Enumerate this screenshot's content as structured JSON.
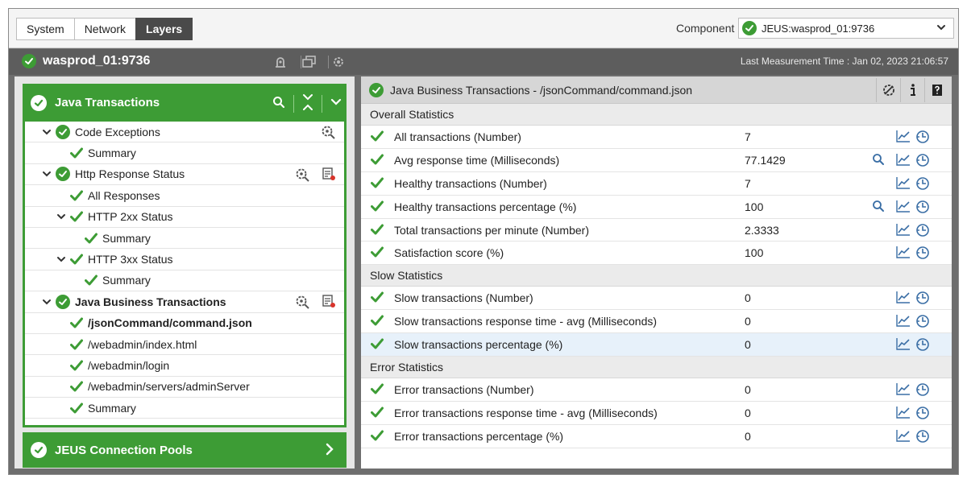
{
  "tabs": [
    {
      "label": "System",
      "active": false
    },
    {
      "label": "Network",
      "active": false
    },
    {
      "label": "Layers",
      "active": true
    }
  ],
  "component": {
    "label": "Component",
    "selected": "JEUS:wasprod_01:9736"
  },
  "host": {
    "title": "wasprod_01:9736",
    "last_measurement": "Last Measurement Time : Jan 02, 2023 21:06:57"
  },
  "left_panel": {
    "header": "Java Transactions",
    "tree": [
      {
        "label": "Code Exceptions",
        "level": 0,
        "caret": true,
        "status": "circle",
        "bold": false,
        "icons": [
          "gear"
        ]
      },
      {
        "label": "Summary",
        "level": 1,
        "caret": false,
        "status": "tick",
        "bold": false,
        "icons": []
      },
      {
        "label": "Http Response Status",
        "level": 0,
        "caret": true,
        "status": "circle",
        "bold": false,
        "icons": [
          "gear",
          "report"
        ]
      },
      {
        "label": "All Responses",
        "level": 1,
        "caret": false,
        "status": "tick",
        "bold": false,
        "icons": []
      },
      {
        "label": "HTTP 2xx Status",
        "level": 1,
        "caret": true,
        "status": "tick",
        "bold": false,
        "icons": []
      },
      {
        "label": "Summary",
        "level": 2,
        "caret": false,
        "status": "tick",
        "bold": false,
        "icons": []
      },
      {
        "label": "HTTP 3xx Status",
        "level": 1,
        "caret": true,
        "status": "tick",
        "bold": false,
        "icons": []
      },
      {
        "label": "Summary",
        "level": 2,
        "caret": false,
        "status": "tick",
        "bold": false,
        "icons": []
      },
      {
        "label": "Java Business Transactions",
        "level": 0,
        "caret": true,
        "status": "circle",
        "bold": true,
        "icons": [
          "gear",
          "report"
        ]
      },
      {
        "label": "/jsonCommand/command.json",
        "level": 1,
        "caret": false,
        "status": "tick",
        "bold": true,
        "icons": []
      },
      {
        "label": "/webadmin/index.html",
        "level": 1,
        "caret": false,
        "status": "tick",
        "bold": false,
        "icons": []
      },
      {
        "label": "/webadmin/login",
        "level": 1,
        "caret": false,
        "status": "tick",
        "bold": false,
        "icons": []
      },
      {
        "label": "/webadmin/servers/adminServer",
        "level": 1,
        "caret": false,
        "status": "tick",
        "bold": false,
        "icons": []
      },
      {
        "label": "Summary",
        "level": 1,
        "caret": false,
        "status": "tick",
        "bold": false,
        "icons": []
      }
    ],
    "footer": "JEUS Connection Pools"
  },
  "right_panel": {
    "title": "Java Business Transactions - /jsonCommand/command.json",
    "sections": [
      {
        "title": "Overall Statistics",
        "rows": [
          {
            "name": "All transactions (Number)",
            "value": "7",
            "zoom": false,
            "highlight": false
          },
          {
            "name": "Avg response time (Milliseconds)",
            "value": "77.1429",
            "zoom": true,
            "highlight": false
          },
          {
            "name": "Healthy transactions (Number)",
            "value": "7",
            "zoom": false,
            "highlight": false
          },
          {
            "name": "Healthy transactions percentage (%)",
            "value": "100",
            "zoom": true,
            "highlight": false
          },
          {
            "name": "Total transactions per minute (Number)",
            "value": "2.3333",
            "zoom": false,
            "highlight": false
          },
          {
            "name": "Satisfaction score (%)",
            "value": "100",
            "zoom": false,
            "highlight": false
          }
        ]
      },
      {
        "title": "Slow Statistics",
        "rows": [
          {
            "name": "Slow transactions (Number)",
            "value": "0",
            "zoom": false,
            "highlight": false
          },
          {
            "name": "Slow transactions response time - avg (Milliseconds)",
            "value": "0",
            "zoom": false,
            "highlight": false
          },
          {
            "name": "Slow transactions percentage (%)",
            "value": "0",
            "zoom": false,
            "highlight": true
          }
        ]
      },
      {
        "title": "Error Statistics",
        "rows": [
          {
            "name": "Error transactions (Number)",
            "value": "0",
            "zoom": false,
            "highlight": false
          },
          {
            "name": "Error transactions response time - avg (Milliseconds)",
            "value": "0",
            "zoom": false,
            "highlight": false
          },
          {
            "name": "Error transactions percentage (%)",
            "value": "0",
            "zoom": false,
            "highlight": false
          }
        ]
      }
    ]
  },
  "colors": {
    "status_green": "#3d9c35",
    "dark_bar": "#5d5d5d",
    "icon_blue": "#3a6ea5"
  }
}
